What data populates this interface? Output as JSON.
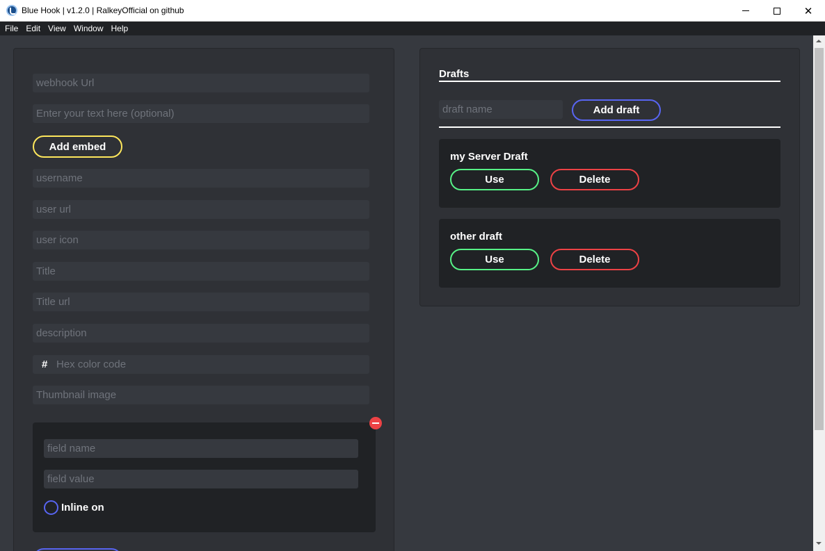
{
  "window": {
    "title": "Blue Hook | v1.2.0 | RalkeyOfficial on github",
    "close_glyph": "✕"
  },
  "menu": [
    "File",
    "Edit",
    "View",
    "Window",
    "Help"
  ],
  "colors": {
    "background": "#36393f",
    "panel": "#2f3136",
    "card": "#202225",
    "accent_blue": "#5865f2",
    "accent_yellow": "#fee75c",
    "accent_green": "#57f287",
    "accent_red": "#ed4245"
  },
  "form": {
    "webhook_url_placeholder": "webhook Url",
    "text_placeholder": "Enter your text here (optional)",
    "add_embed_label": "Add embed",
    "username_placeholder": "username",
    "user_url_placeholder": "user url",
    "user_icon_placeholder": "user icon",
    "title_placeholder": "Title",
    "title_url_placeholder": "Title url",
    "description_placeholder": "description",
    "hex_symbol": "#",
    "hex_placeholder": "Hex color code",
    "thumbnail_placeholder": "Thumbnail image",
    "field": {
      "name_placeholder": "field name",
      "value_placeholder": "field value",
      "inline_label": "Inline on"
    }
  },
  "drafts": {
    "title": "Drafts",
    "name_placeholder": "draft name",
    "add_label": "Add draft",
    "items": [
      {
        "name": "my Server Draft",
        "use_label": "Use",
        "delete_label": "Delete"
      },
      {
        "name": "other draft",
        "use_label": "Use",
        "delete_label": "Delete"
      }
    ]
  },
  "icons": [
    "app-logo-icon",
    "minimize-icon",
    "maximize-icon",
    "close-icon",
    "remove-field-icon"
  ]
}
